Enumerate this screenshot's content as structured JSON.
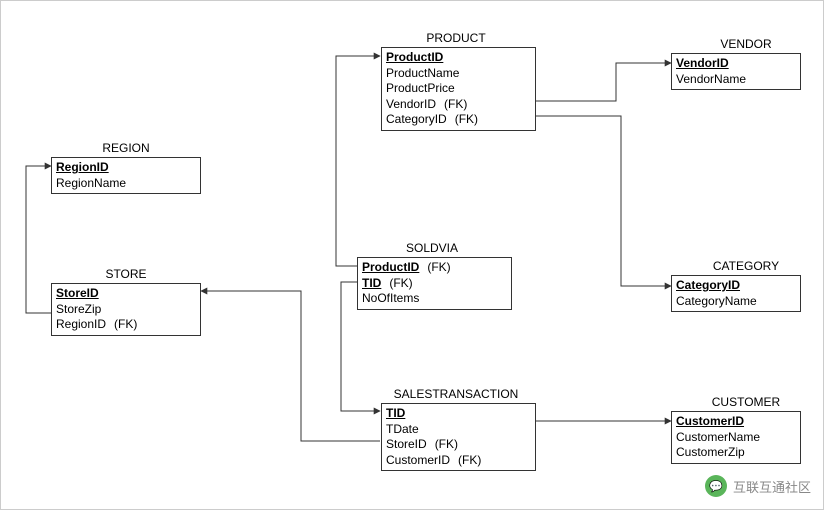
{
  "diagram": {
    "type": "entity-relationship",
    "entities": {
      "region": {
        "title": "REGION",
        "attributes": [
          {
            "name": "RegionID",
            "pk": true
          },
          {
            "name": "RegionName"
          }
        ]
      },
      "store": {
        "title": "STORE",
        "attributes": [
          {
            "name": "StoreID",
            "pk": true
          },
          {
            "name": "StoreZip"
          },
          {
            "name": "RegionID",
            "fk": true,
            "tag": "(FK)"
          }
        ]
      },
      "product": {
        "title": "PRODUCT",
        "attributes": [
          {
            "name": "ProductID",
            "pk": true
          },
          {
            "name": "ProductName"
          },
          {
            "name": "ProductPrice"
          },
          {
            "name": "VendorID",
            "fk": true,
            "tag": "(FK)"
          },
          {
            "name": "CategoryID",
            "fk": true,
            "tag": "(FK)"
          }
        ]
      },
      "vendor": {
        "title": "VENDOR",
        "attributes": [
          {
            "name": "VendorID",
            "pk": true
          },
          {
            "name": "VendorName"
          }
        ]
      },
      "category": {
        "title": "CATEGORY",
        "attributes": [
          {
            "name": "CategoryID",
            "pk": true
          },
          {
            "name": "CategoryName"
          }
        ]
      },
      "soldvia": {
        "title": "SOLDVIA",
        "attributes": [
          {
            "name": "ProductID",
            "pk": true,
            "fk": true,
            "tag": "(FK)"
          },
          {
            "name": "TID",
            "pk": true,
            "fk": true,
            "tag": "(FK)"
          },
          {
            "name": "NoOfItems"
          }
        ]
      },
      "salestransaction": {
        "title": "SALESTRANSACTION",
        "attributes": [
          {
            "name": "TID",
            "pk": true
          },
          {
            "name": "TDate"
          },
          {
            "name": "StoreID",
            "fk": true,
            "tag": "(FK)"
          },
          {
            "name": "CustomerID",
            "fk": true,
            "tag": "(FK)"
          }
        ]
      },
      "customer": {
        "title": "CUSTOMER",
        "attributes": [
          {
            "name": "CustomerID",
            "pk": true
          },
          {
            "name": "CustomerName"
          },
          {
            "name": "CustomerZip"
          }
        ]
      }
    },
    "relationships": [
      {
        "from": "store",
        "from_attr": "RegionID",
        "to": "region",
        "to_attr": "RegionID"
      },
      {
        "from": "product",
        "from_attr": "VendorID",
        "to": "vendor",
        "to_attr": "VendorID"
      },
      {
        "from": "product",
        "from_attr": "CategoryID",
        "to": "category",
        "to_attr": "CategoryID"
      },
      {
        "from": "soldvia",
        "from_attr": "ProductID",
        "to": "product",
        "to_attr": "ProductID"
      },
      {
        "from": "soldvia",
        "from_attr": "TID",
        "to": "salestransaction",
        "to_attr": "TID"
      },
      {
        "from": "salestransaction",
        "from_attr": "StoreID",
        "to": "store",
        "to_attr": "StoreID"
      },
      {
        "from": "salestransaction",
        "from_attr": "CustomerID",
        "to": "customer",
        "to_attr": "CustomerID"
      }
    ]
  },
  "watermark": {
    "label": "互联互通社区"
  }
}
